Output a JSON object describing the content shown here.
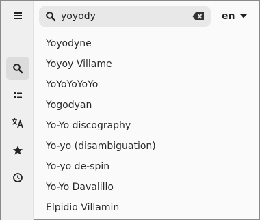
{
  "search": {
    "value": "yoyody"
  },
  "language": {
    "selected": "en"
  },
  "rail": {
    "items": [
      {
        "name": "menu",
        "icon": "hamburger-icon"
      },
      {
        "name": "search",
        "icon": "search-icon"
      },
      {
        "name": "contents",
        "icon": "list-icon"
      },
      {
        "name": "languages",
        "icon": "translate-icon"
      },
      {
        "name": "saved",
        "icon": "star-icon"
      },
      {
        "name": "history",
        "icon": "history-icon"
      }
    ]
  },
  "results": [
    {
      "title": "Yoyodyne"
    },
    {
      "title": "Yoyoy Villame"
    },
    {
      "title": "YoYoYoYoYo"
    },
    {
      "title": "Yogodyan"
    },
    {
      "title": "Yo-Yo discography"
    },
    {
      "title": "Yo-yo (disambiguation)"
    },
    {
      "title": "Yo-yo de-spin"
    },
    {
      "title": "Yo-Yo Davalillo"
    },
    {
      "title": "Elpidio Villamin"
    }
  ]
}
